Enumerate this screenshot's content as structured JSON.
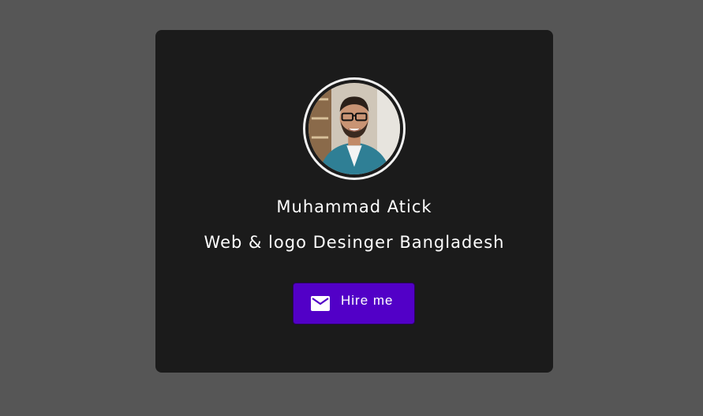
{
  "profile": {
    "name": "Muhammad Atick",
    "role": "Web & logo Desinger Bangladesh",
    "avatar_icon": "profile-photo"
  },
  "actions": {
    "hire_label": "Hire me",
    "hire_icon": "mail-icon"
  },
  "colors": {
    "page_background": "#565656",
    "card_background": "#1b1b1b",
    "accent": "#5200c7",
    "text": "#ffffff"
  }
}
